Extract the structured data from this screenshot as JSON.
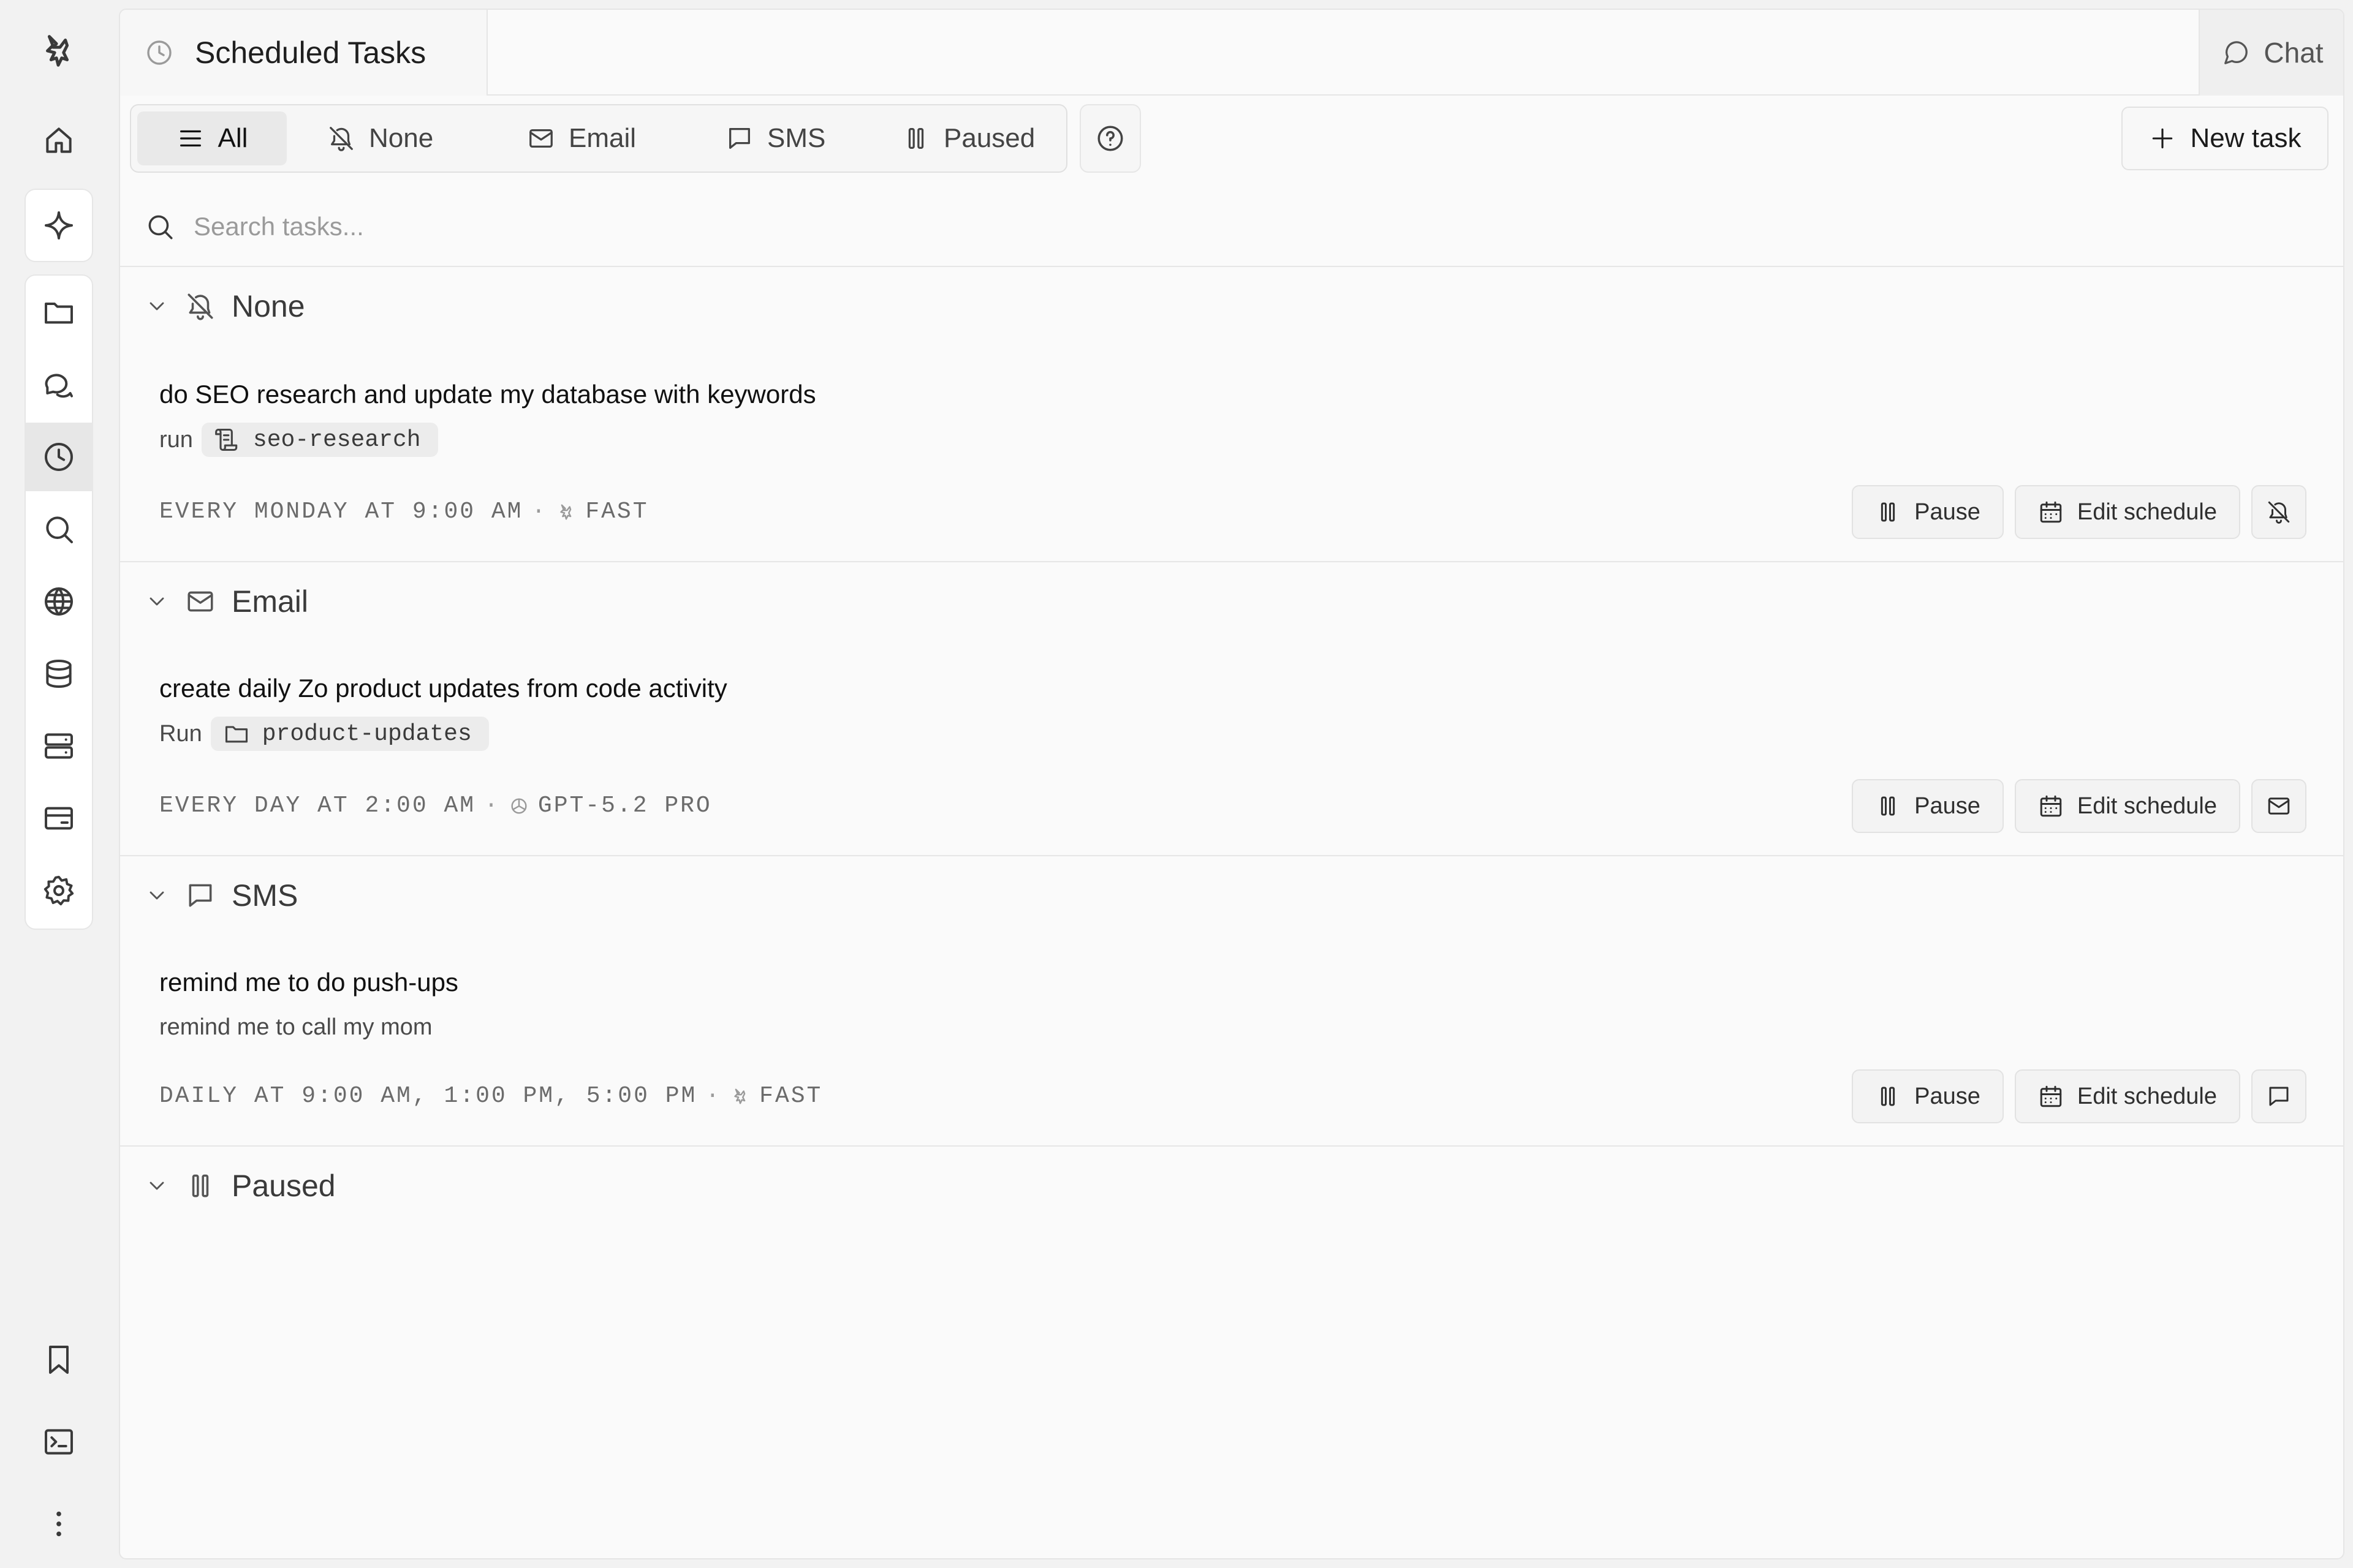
{
  "header": {
    "page_title": "Scheduled Tasks",
    "chat_label": "Chat"
  },
  "filters": [
    {
      "label": "All",
      "icon": "menu-icon",
      "active": true
    },
    {
      "label": "None",
      "icon": "bell-off-icon"
    },
    {
      "label": "Email",
      "icon": "mail-icon"
    },
    {
      "label": "SMS",
      "icon": "message-square-icon"
    },
    {
      "label": "Paused",
      "icon": "pause-icon"
    }
  ],
  "toolbar": {
    "new_task_label": "New task"
  },
  "search": {
    "placeholder": "Search tasks..."
  },
  "sections": [
    {
      "label": "None",
      "icon": "bell-off-icon",
      "tasks": [
        {
          "title": "do SEO research and update my database with keywords",
          "prefix": "run",
          "chip_icon": "script-icon",
          "chip": "seo-research",
          "schedule": "EVERY MONDAY AT 9:00 AM",
          "separator": "·",
          "model_icon": "zo-logo-icon",
          "model": "FAST",
          "pause_label": "Pause",
          "edit_label": "Edit schedule",
          "channel_icon": "bell-off-icon"
        }
      ]
    },
    {
      "label": "Email",
      "icon": "mail-icon",
      "tasks": [
        {
          "title": "create daily Zo product updates from code activity",
          "prefix": "Run",
          "chip_icon": "folder-icon",
          "chip": "product-updates",
          "schedule": "EVERY DAY AT 2:00 AM",
          "separator": "·",
          "model_icon": "openai-icon",
          "model": "GPT-5.2 PRO",
          "pause_label": "Pause",
          "edit_label": "Edit schedule",
          "channel_icon": "mail-icon"
        }
      ]
    },
    {
      "label": "SMS",
      "icon": "message-square-icon",
      "tasks": [
        {
          "title": "remind me to do push-ups",
          "subtitle": "remind me to call my mom",
          "schedule": "DAILY AT 9:00 AM, 1:00 PM, 5:00 PM",
          "separator": "·",
          "model_icon": "zo-logo-icon",
          "model": "FAST",
          "pause_label": "Pause",
          "edit_label": "Edit schedule",
          "channel_icon": "message-square-icon"
        }
      ]
    },
    {
      "label": "Paused",
      "icon": "pause-icon",
      "tasks": []
    }
  ],
  "sidebar": {
    "items": [
      "home-icon",
      "sparkle-icon",
      "folder-icon",
      "chats-icon",
      "clock-icon",
      "search-icon",
      "globe-icon",
      "database-icon",
      "server-icon",
      "card-icon",
      "settings-icon",
      "bookmark-icon",
      "terminal-icon",
      "more-vertical-icon"
    ],
    "active": "clock-icon"
  },
  "colors": {
    "background": "#f2f2f2",
    "panel": "#fafafa",
    "border": "#e6e6e6",
    "text": "#1b1b1b",
    "muted": "#6b6b6b"
  }
}
